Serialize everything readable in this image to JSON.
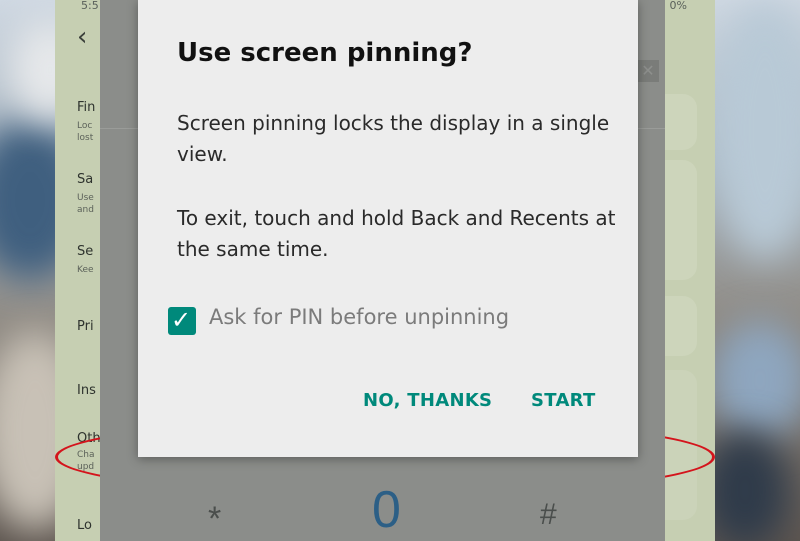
{
  "status_bar": {
    "time": "5:5",
    "battery": "0%"
  },
  "settings": {
    "items": [
      {
        "title": "Fin",
        "subtitle": [
          "Loc",
          "lost"
        ]
      },
      {
        "title": "Sa",
        "subtitle": [
          "Use",
          "and"
        ]
      },
      {
        "title": "Se",
        "subtitle": [
          "Kee"
        ]
      },
      {
        "title": "Pri",
        "subtitle": []
      },
      {
        "title": "Ins",
        "subtitle": []
      },
      {
        "title": "Oth",
        "subtitle": [
          "Cha",
          "upd"
        ]
      },
      {
        "title": "Lo",
        "subtitle": []
      }
    ],
    "toggle_states": {
      "other": true,
      "below": true
    }
  },
  "keypad": {
    "keys": [
      "*",
      "0",
      "#"
    ]
  },
  "dialog": {
    "title": "Use screen pinning?",
    "body_1": "Screen pinning locks the display in a single view.",
    "body_2": "To exit, touch and hold Back and Recents at the same time.",
    "pin_checkbox": {
      "label": "Ask for PIN before unpinning",
      "checked": true
    },
    "buttons": {
      "no_thanks": "NO, THANKS",
      "start": "START"
    }
  },
  "colors": {
    "accent": "#00897b",
    "highlight_circle": "#d4141c",
    "toggle_on": "#1d7fd4"
  }
}
